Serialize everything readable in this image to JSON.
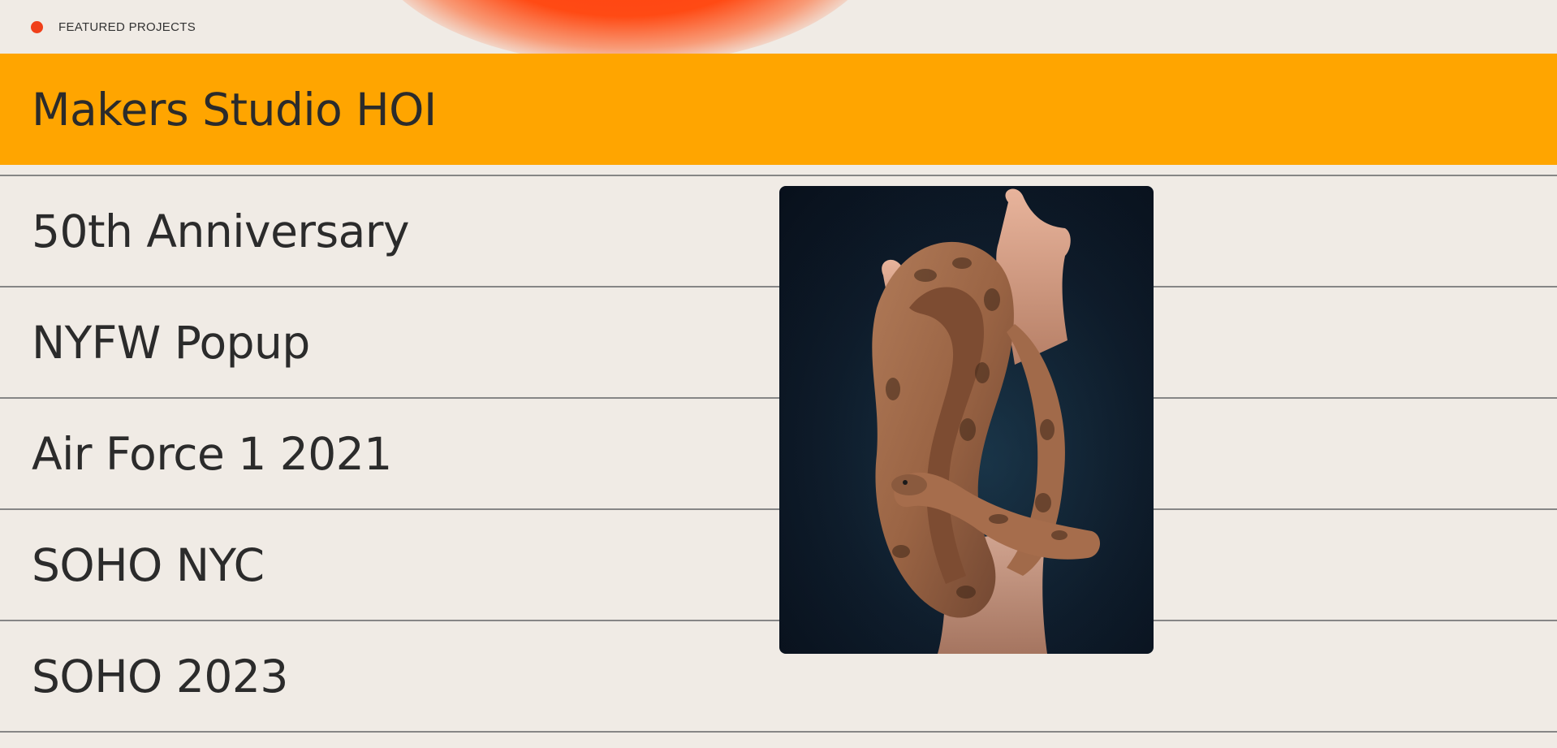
{
  "header": {
    "section_label": "FEATURED PROJECTS"
  },
  "projects": [
    {
      "title": "Makers Studio HOI",
      "active": true
    },
    {
      "title": "50th Anniversary",
      "active": false
    },
    {
      "title": "NYFW Popup",
      "active": false
    },
    {
      "title": "Air Force 1 2021",
      "active": false
    },
    {
      "title": "SOHO NYC",
      "active": false
    },
    {
      "title": "SOHO 2023",
      "active": false
    }
  ],
  "preview": {
    "image_subject": "snake-on-hand-photo"
  },
  "colors": {
    "background": "#f0ebe5",
    "active_row": "#ffa500",
    "accent_dot": "#f0401a",
    "text": "#2b2b2b",
    "divider": "#868686"
  }
}
